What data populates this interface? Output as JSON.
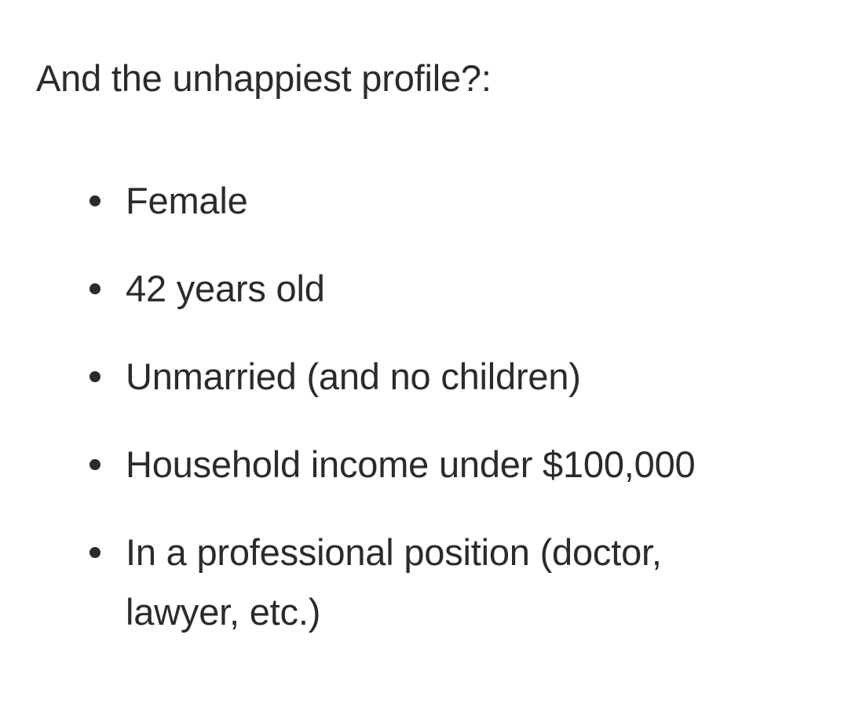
{
  "heading": "And the unhappiest profile?:",
  "profile_items": [
    {
      "text": "Female",
      "marker_icon": "bullet-dot-icon"
    },
    {
      "text": "42 years old",
      "marker_icon": "bullet-dot-icon"
    },
    {
      "text": "Unmarried (and no children)",
      "marker_icon": "bullet-dot-icon"
    },
    {
      "text": "Household income under $100,000",
      "marker_icon": "bullet-dot-icon"
    },
    {
      "text": "In a professional position (doctor, lawyer, etc.)",
      "marker_icon": "bullet-dot-icon"
    }
  ]
}
